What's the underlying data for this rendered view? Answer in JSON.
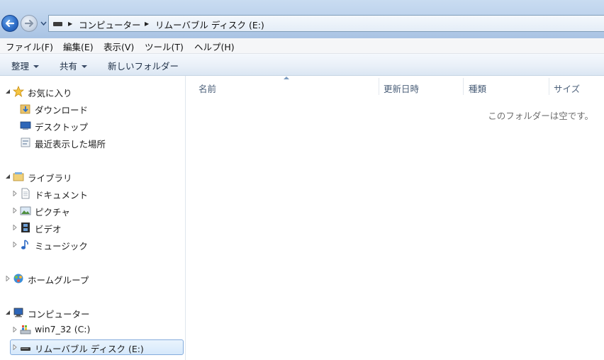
{
  "address": {
    "segments": [
      "コンピューター",
      "リムーバブル ディスク (E:)"
    ]
  },
  "menu": [
    "ファイル(F)",
    "編集(E)",
    "表示(V)",
    "ツール(T)",
    "ヘルプ(H)"
  ],
  "toolbar": {
    "organize": "整理",
    "share": "共有",
    "new_folder": "新しいフォルダー"
  },
  "nav": {
    "favorites": "お気に入り",
    "downloads": "ダウンロード",
    "desktop": "デスクトップ",
    "recent": "最近表示した場所",
    "libraries": "ライブラリ",
    "documents": "ドキュメント",
    "pictures": "ピクチャ",
    "videos": "ビデオ",
    "music": "ミュージック",
    "homegroup": "ホームグループ",
    "computer": "コンピューター",
    "drive_c": "win7_32 (C:)",
    "drive_e": "リムーバブル ディスク (E:)"
  },
  "columns": {
    "name": "名前",
    "modified": "更新日時",
    "type": "種類",
    "size": "サイズ"
  },
  "empty_message": "このフォルダーは空です。",
  "colors": {
    "selection": "#d6e8fb",
    "selection_border": "#84acdd",
    "header_text": "#4c607a"
  }
}
